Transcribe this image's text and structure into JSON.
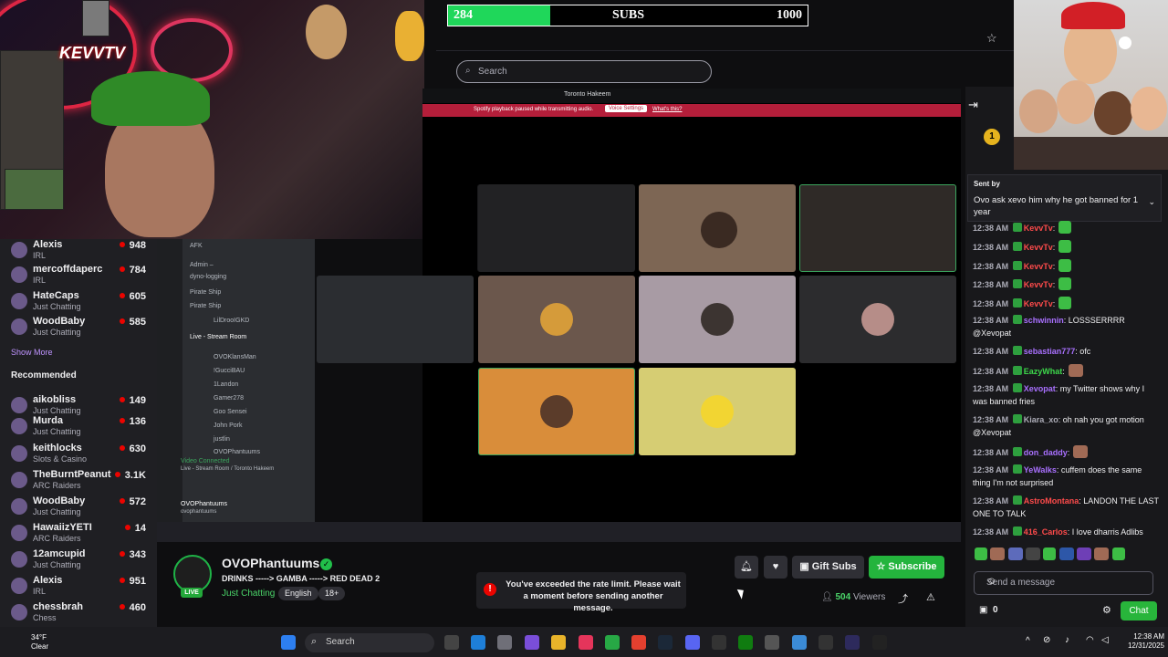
{
  "sub_goal": {
    "current": "284",
    "label": "SUBS",
    "target": "1000",
    "progress_fraction": 0.284
  },
  "search": {
    "placeholder": "Search"
  },
  "discord": {
    "window_title": "Toronto Hakeem",
    "notice_text": "Spotify playback paused while transmitting audio.",
    "notice_button": "Voice Settings",
    "notice_link": "What's this?",
    "channels": [
      "AFK",
      "Admin –",
      "dyno-logging",
      "Pirate Ship",
      "Pirate Ship",
      "LilDrooIGKD",
      "Live - Stream Room",
      "OVOKlansMan",
      "!GucciBAU",
      "1Landon",
      "Gamer278",
      "Goo Sensei",
      "John Pork",
      "justlin",
      "OVOPhantuums"
    ],
    "voice_connected": "Video Connected",
    "voice_channel": "Live - Stream Room / Toronto Hakeem",
    "self_user": "OVOPhantuums",
    "self_handle": "ovophantuums"
  },
  "sidebar": {
    "followed": [
      {
        "name": "Alexis",
        "category": "IRL",
        "viewers": "948"
      },
      {
        "name": "mercoffdaperc",
        "category": "IRL",
        "viewers": "784"
      },
      {
        "name": "HateCaps",
        "category": "Just Chatting",
        "viewers": "605"
      },
      {
        "name": "WoodBaby",
        "category": "Just Chatting",
        "viewers": "585"
      }
    ],
    "show_more": "Show More",
    "recommended_header": "Recommended",
    "recommended": [
      {
        "name": "aikobliss",
        "category": "Just Chatting",
        "viewers": "149"
      },
      {
        "name": "Murda",
        "category": "Just Chatting",
        "viewers": "136"
      },
      {
        "name": "keithlocks",
        "category": "Slots & Casino",
        "viewers": "630"
      },
      {
        "name": "TheBurntPeanut",
        "category": "ARC Raiders",
        "viewers": "3.1K"
      },
      {
        "name": "WoodBaby",
        "category": "Just Chatting",
        "viewers": "572"
      },
      {
        "name": "HawaiizYETI",
        "category": "ARC Raiders",
        "viewers": "14"
      },
      {
        "name": "12amcupid",
        "category": "Just Chatting",
        "viewers": "343"
      },
      {
        "name": "Alexis",
        "category": "IRL",
        "viewers": "951"
      },
      {
        "name": "chessbrah",
        "category": "Chess",
        "viewers": "460"
      }
    ]
  },
  "chat": {
    "pinned_label": "Sent by",
    "pinned_text": "Ovo ask xevo him why he got banned for 1 year",
    "messages": [
      {
        "ts": "12:38 AM",
        "user": "KevvTv",
        "color": "#ff4b4b",
        "text": ":"
      },
      {
        "ts": "12:38 AM",
        "user": "KevvTv",
        "color": "#ff4b4b",
        "text": ":"
      },
      {
        "ts": "12:38 AM",
        "user": "KevvTv",
        "color": "#ff4b4b",
        "text": ":"
      },
      {
        "ts": "12:38 AM",
        "user": "KevvTv",
        "color": "#ff4b4b",
        "text": ":"
      },
      {
        "ts": "12:38 AM",
        "user": "KevvTv",
        "color": "#ff4b4b",
        "text": ":"
      },
      {
        "ts": "12:38 AM",
        "user": "schwinnin",
        "color": "#a970ff",
        "text": ": LOSSSERRRR @Xevopat"
      },
      {
        "ts": "12:38 AM",
        "user": "sebastian777",
        "color": "#a970ff",
        "text": ": ofc"
      },
      {
        "ts": "12:38 AM",
        "user": "EazyWhat",
        "color": "#3dd84b",
        "text": ":"
      },
      {
        "ts": "12:38 AM",
        "user": "Xevopat",
        "color": "#a970ff",
        "text": ": my Twitter shows why I was banned fries"
      },
      {
        "ts": "12:38 AM",
        "user": "Kiara_xo",
        "color": "#adadb8",
        "text": ": oh nah you got motion @Xevopat"
      },
      {
        "ts": "12:38 AM",
        "user": "don_daddy",
        "color": "#a970ff",
        "text": ":"
      },
      {
        "ts": "12:38 AM",
        "user": "YeWalks",
        "color": "#a970ff",
        "text": ": cuffem does the same thing I'm not surprised"
      },
      {
        "ts": "12:38 AM",
        "user": "AstroMontana",
        "color": "#ff4b4b",
        "text": ": LANDON THE LAST ONE TO TALK"
      },
      {
        "ts": "12:38 AM",
        "user": "416_Carlos",
        "color": "#ff4b4b",
        "text": ": I love dharris Adlibs"
      }
    ],
    "input_placeholder": "Send a message",
    "points": "0",
    "chat_button": "Chat"
  },
  "stream": {
    "channel": "OVOPhantuums",
    "live_label": "LIVE",
    "title": "DRINKS -----> GAMBA -----> RED DEAD 2",
    "category": "Just Chatting",
    "tags": [
      "English",
      "18+"
    ],
    "viewers_count": "504",
    "viewers_label": "Viewers",
    "gift_subs": "Gift Subs",
    "subscribe": "Subscribe",
    "toast": "You've exceeded the rate limit. Please wait a moment before sending another message."
  },
  "taskbar": {
    "temp": "34°F",
    "condition": "Clear",
    "search": "Search",
    "time": "12:38 AM",
    "date": "12/31/2025"
  },
  "overlay": {
    "webcam_text": "KEVVTV"
  },
  "colors": {
    "accent": "#24b43d",
    "live_red": "#eb0400",
    "subgoal_green": "#1fd75a"
  }
}
